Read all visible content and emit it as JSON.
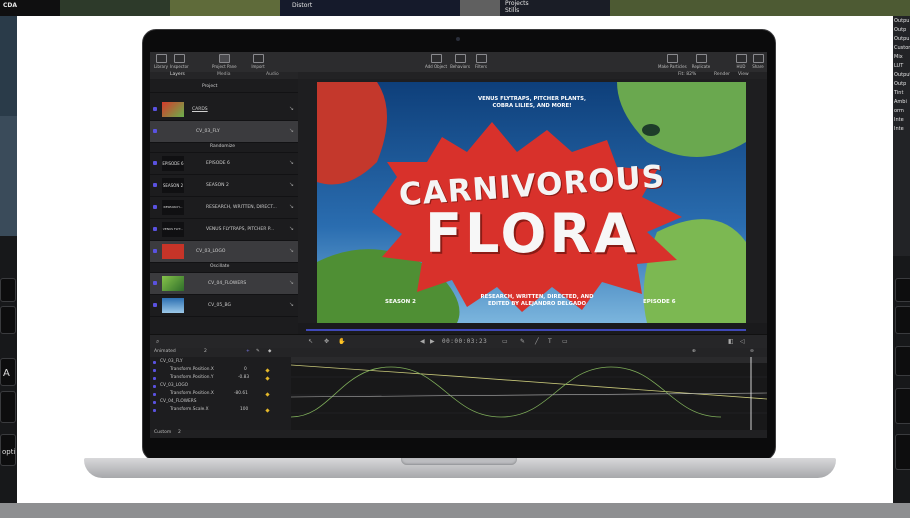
{
  "background": {
    "top_strip": {
      "left_label": "CDA",
      "menu_item_1": "Distort",
      "menu_item_2": "Projects",
      "menu_item_3": "Stills"
    },
    "right_edge_labels": [
      "Outpu",
      "Outp",
      "Outpu",
      "Custom",
      "Mix",
      "LUT",
      "Output",
      "Outp",
      "Tint",
      "Ambi",
      "orm",
      "Inte",
      "Inte"
    ],
    "keyboard": {
      "left_key_a": "A",
      "left_key_opt": "opti"
    }
  },
  "toolbar": {
    "library_label": "Library",
    "inspector_label": "Inspector",
    "project_pane_label": "Project Pane",
    "import_label": "Import",
    "add_object_label": "Add Object",
    "behaviors_label": "Behaviors",
    "filters_label": "Filters",
    "make_particles_label": "Make Particles",
    "replicate_label": "Replicate",
    "hud_label": "HUD",
    "share_label": "Share"
  },
  "tabs": {
    "layers": "Layers",
    "media": "Media",
    "audio": "Audio"
  },
  "viewer_bar": {
    "fit": "Fit: 82%",
    "render": "Render",
    "view": "View"
  },
  "layers": [
    {
      "name": "Project",
      "thumb": ""
    },
    {
      "name": "CARDS",
      "thumb": ""
    },
    {
      "name": "CV_03_FLY",
      "thumb": ""
    },
    {
      "name": "Randomize",
      "thumb": ""
    },
    {
      "name": "EPISODE 6",
      "thumb": "EPISODE 6"
    },
    {
      "name": "SEASON 2",
      "thumb": "SEASON 2"
    },
    {
      "name": "RESEARCH, WRITTEN, DIRECT...",
      "thumb": "RESEARCH..."
    },
    {
      "name": "VENUS FLYTRAPS, PITCHER P...",
      "thumb": "VENUS FLYT..."
    },
    {
      "name": "CV_03_LOGO",
      "thumb": ""
    },
    {
      "name": "Oscillate",
      "thumb": ""
    },
    {
      "name": "CV_04_FLOWERS",
      "thumb": ""
    },
    {
      "name": "CV_05_BG",
      "thumb": ""
    }
  ],
  "poster": {
    "top_text_1": "VENUS FLYTRAPS, PITCHER PLANTS,",
    "top_text_2": "COBRA LILIES, AND MORE!",
    "title_1": "CARNIVOROUS",
    "title_2": "FLORA",
    "season": "SEASON 2",
    "credit_1": "RESEARCH, WRITTEN, DIRECTED, AND",
    "credit_2": "EDITED BY ALEJANDRO DELGADO",
    "episode": "EPISODE 6"
  },
  "timecode": "00:00:03:23",
  "keyframe_header": {
    "animated": "Animated",
    "count": "2"
  },
  "params": [
    {
      "name": "CV_03_FLY",
      "value": "",
      "group": true
    },
    {
      "name": "Transform.Position.X",
      "value": "0"
    },
    {
      "name": "Transform.Position.Y",
      "value": "-0.83"
    },
    {
      "name": "CV_03_LOGO",
      "value": "",
      "group": true
    },
    {
      "name": "Transform.Position.X",
      "value": "-80.61"
    },
    {
      "name": "CV_04_FLOWERS",
      "value": "",
      "group": true
    },
    {
      "name": "Transform.Scale.X",
      "value": "100"
    }
  ],
  "footer": {
    "custom": "Custom",
    "custom_count": "2"
  },
  "colors": {
    "accent": "#5a52e0",
    "poster_red": "#d8312b",
    "poster_sky": "#1b5fa3",
    "playhead": "#ffffff"
  }
}
